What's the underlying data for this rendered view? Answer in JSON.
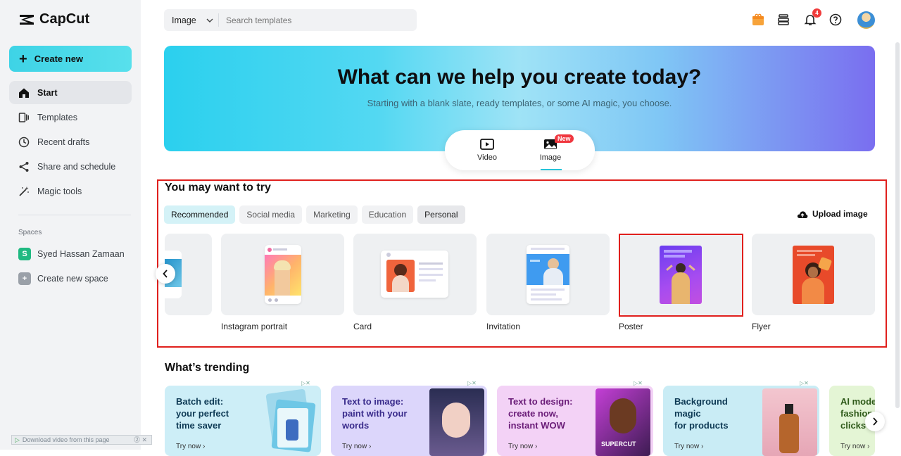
{
  "app": {
    "name": "CapCut"
  },
  "sidebar": {
    "create_label": "Create new",
    "items": [
      {
        "label": "Start",
        "icon": "home-icon"
      },
      {
        "label": "Templates",
        "icon": "templates-icon"
      },
      {
        "label": "Recent drafts",
        "icon": "clock-icon"
      },
      {
        "label": "Share and schedule",
        "icon": "share-icon"
      },
      {
        "label": "Magic tools",
        "icon": "magic-wand-icon"
      }
    ],
    "spaces_label": "Spaces",
    "spaces": [
      {
        "label": "Syed Hassan Zamaan",
        "initial": "S",
        "color": "#1fb981"
      },
      {
        "label": "Create new space",
        "initial": "+",
        "color": "#9aa0a8"
      }
    ]
  },
  "search": {
    "type_label": "Image",
    "placeholder": "Search templates"
  },
  "header": {
    "notification_count": "4"
  },
  "hero": {
    "title": "What can we help you create today?",
    "subtitle": "Starting with a blank slate, ready templates, or some AI magic, you choose.",
    "tabs": [
      {
        "label": "Video"
      },
      {
        "label": "Image"
      }
    ],
    "new_badge": "New"
  },
  "try": {
    "title": "You may want to try",
    "chips": [
      "Recommended",
      "Social media",
      "Marketing",
      "Education",
      "Personal"
    ],
    "upload_label": "Upload image",
    "cards": [
      "Instagram portrait",
      "Card",
      "Invitation",
      "Poster",
      "Flyer"
    ]
  },
  "trending": {
    "title": "What’s trending",
    "cards": [
      {
        "line1": "Batch edit:",
        "line2": "your perfect",
        "line3": "time saver",
        "cta": "Try now",
        "bg": "#cdeef7",
        "color": "#0e3a55"
      },
      {
        "line1": "Text to image:",
        "line2": "paint with your",
        "line3": "words",
        "cta": "Try now",
        "bg": "#dcd6fb",
        "color": "#3a2c8c"
      },
      {
        "line1": "Text to design:",
        "line2": "create now,",
        "line3": "instant WOW",
        "cta": "Try now",
        "bg": "#f3d2f6",
        "color": "#6a1c78"
      },
      {
        "line1": "Background",
        "line2": "magic",
        "line3": "for products",
        "cta": "Try now",
        "bg": "#c9ecf5",
        "color": "#0e3a55"
      },
      {
        "line1": "AI mode",
        "line2": "fashion",
        "line3": "clicks",
        "cta": "Try now",
        "bg": "#e4f5d5",
        "color": "#2f5a1a"
      }
    ],
    "supercut_label": "SUPERCUT"
  },
  "download_bar": {
    "label": "Download video from this page"
  }
}
